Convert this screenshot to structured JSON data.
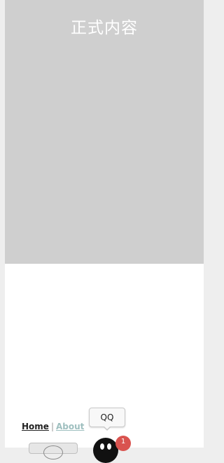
{
  "main": {
    "title": "正式内容"
  },
  "footer": {
    "nav": {
      "home_label": "Home",
      "separator": "|",
      "about_label": "About"
    }
  },
  "dock": {
    "tooltip_label": "QQ",
    "qq_icon": "qq-penguin-icon",
    "badge_count": "1"
  },
  "colors": {
    "content_panel_bg": "#cfcfcf",
    "about_link": "#9ebfbf",
    "badge": "#d9534f"
  }
}
